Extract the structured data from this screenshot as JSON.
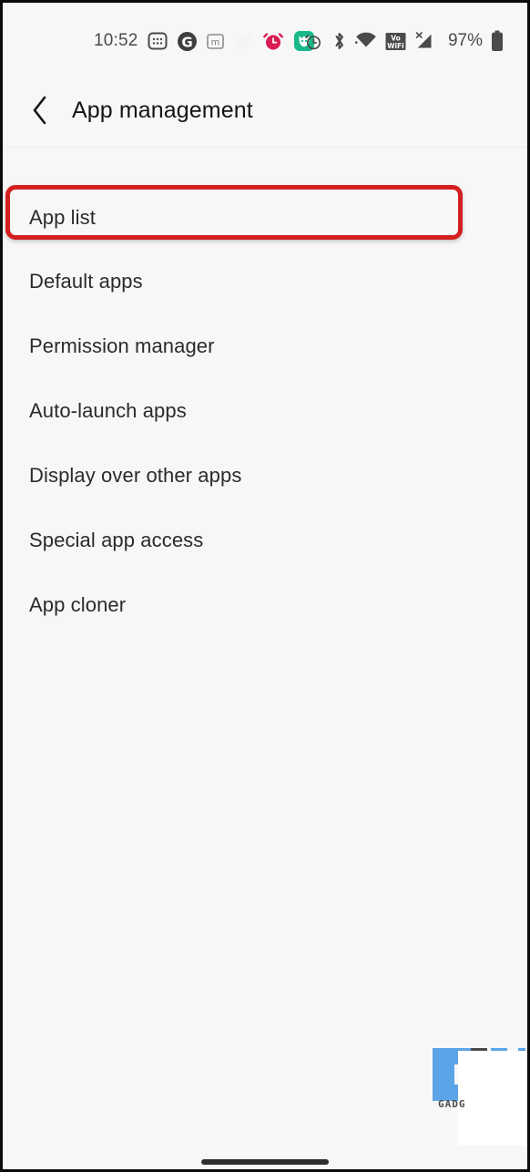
{
  "status_bar": {
    "time": "10:52",
    "battery_percent": "97%",
    "left_icons": [
      {
        "name": "calculator-icon",
        "glyph": "calculator"
      },
      {
        "name": "groupon-g-icon",
        "glyph": "G"
      },
      {
        "name": "mendeley-m-icon",
        "glyph": "m"
      },
      {
        "name": "twitter-bird-icon",
        "glyph": "bird"
      },
      {
        "name": "alarm-notification-icon",
        "glyph": "alarm-red"
      },
      {
        "name": "mi-home-icon",
        "glyph": "mi-green"
      }
    ],
    "right_icons": [
      {
        "name": "alarm-clock-icon",
        "glyph": "alarm"
      },
      {
        "name": "bluetooth-icon",
        "glyph": "bluetooth"
      },
      {
        "name": "wifi-icon",
        "glyph": "wifi"
      },
      {
        "name": "vowifi-icon",
        "glyph": "VoWiFi"
      },
      {
        "name": "cellular-signal-no-sim-icon",
        "glyph": "signal-x"
      },
      {
        "name": "battery-icon",
        "glyph": "battery"
      }
    ],
    "colors": {
      "alarm_red": "#d81b52",
      "mi_green": "#19b88a",
      "twitter_blue": "#f2f2f2",
      "icon_gray": "#4a4a4a"
    }
  },
  "header": {
    "back_label": "back",
    "title": "App management"
  },
  "list": {
    "items": [
      {
        "label": "App list",
        "highlighted": true
      },
      {
        "label": "Default apps",
        "highlighted": false
      },
      {
        "label": "Permission manager",
        "highlighted": false
      },
      {
        "label": "Auto-launch apps",
        "highlighted": false
      },
      {
        "label": "Display over other apps",
        "highlighted": false
      },
      {
        "label": "Special app access",
        "highlighted": false
      },
      {
        "label": "App cloner",
        "highlighted": false
      }
    ]
  },
  "annotation": {
    "highlight_color": "#d41f1f",
    "target": "App list"
  },
  "watermark": {
    "text": "GADG",
    "logo_blue": "#5ba4e8",
    "logo_dark": "#4a4a4a"
  },
  "navigation": {
    "gesture_bar": "home-gesture-bar"
  }
}
